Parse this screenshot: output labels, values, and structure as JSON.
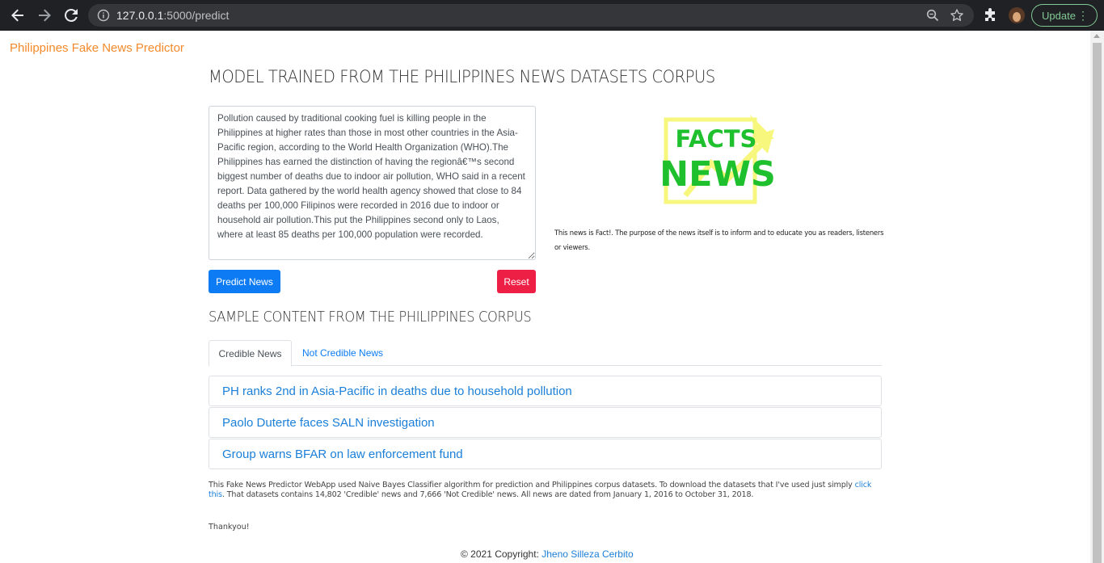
{
  "browser": {
    "url_host": "127.0.0.1",
    "url_rest": ":5000/predict",
    "update_label": "Update"
  },
  "navbar": {
    "brand": "Philippines Fake News Predictor"
  },
  "main": {
    "heading": "MODEL TRAINED FROM THE PHILIPPINES NEWS DATASETS CORPUS",
    "news_text": "Pollution caused by traditional cooking fuel is killing people in the Philippines at higher rates than those in most other countries in the Asia-Pacific region, according to the World Health Organization (WHO).The Philippines has earned the distinction of having the regionâ€™s second biggest number of deaths due to indoor air pollution, WHO said in a recent report. Data gathered by the world health agency showed that close to 84 deaths per 100,000 Filipinos were recorded in 2016 due to indoor or household air pollution.This put the Philippines second only to Laos, where at least 85 deaths per 100,000 population were recorded.",
    "predict_label": "Predict News",
    "reset_label": "Reset",
    "result_logo_top": "FACTS",
    "result_logo_bottom": "NEWS",
    "result_text": "This news is Fact!. The purpose of the news itself is to inform and to educate you as readers, listeners or viewers."
  },
  "samples": {
    "heading": "SAMPLE CONTENT FROM THE PHILIPPINES CORPUS",
    "tabs": [
      {
        "label": "Credible News"
      },
      {
        "label": "Not Credible News"
      }
    ],
    "items": [
      {
        "title": "PH ranks 2nd in Asia-Pacific in deaths due to household pollution"
      },
      {
        "title": "Paolo Duterte faces SALN investigation"
      },
      {
        "title": "Group warns BFAR on law enforcement fund"
      }
    ]
  },
  "about": {
    "text_before": "This Fake News Predictor WebApp used Naive Bayes Classifier algorithm for prediction and Philippines corpus datasets. To download the datasets that I've used just simply ",
    "link": "click this",
    "text_after": ". That datasets contains 14,802 'Credible' news and 7,666 'Not Credible' news. All news are dated from January 1, 2016 to October 31, 2018.",
    "thanks": "Thankyou!"
  },
  "footer": {
    "copyright": "© 2021 Copyright: ",
    "author": "Jheno Silleza Cerbito"
  },
  "colors": {
    "brand": "#f28a2b",
    "primary": "#0d7cf4",
    "danger": "#ee1f44",
    "link": "#1b7fd8",
    "facts_green": "#1fc02e",
    "facts_yellow": "#f6f77c"
  }
}
